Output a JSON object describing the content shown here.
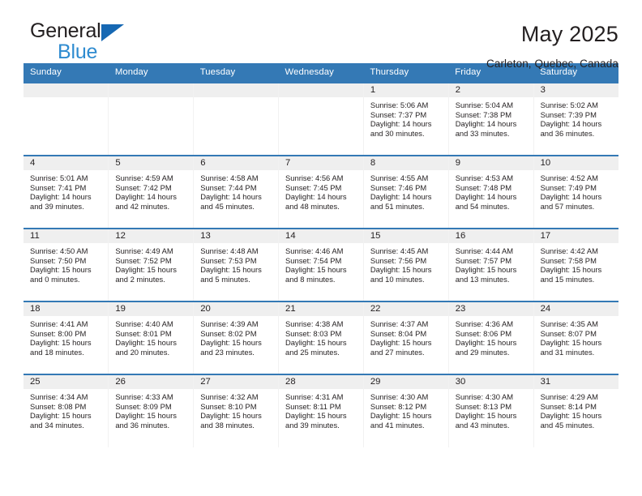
{
  "brand": {
    "name_line1": "General",
    "name_line2": "Blue",
    "triangle_color": "#1668b3",
    "blue_text_color": "#2e8bd0"
  },
  "header": {
    "title": "May 2025",
    "subtitle": "Carleton, Quebec, Canada"
  },
  "theme": {
    "header_bar_color": "#3479b5",
    "daynum_band_color": "#efefef",
    "text_color": "#231f20"
  },
  "weekday_headers": [
    "Sunday",
    "Monday",
    "Tuesday",
    "Wednesday",
    "Thursday",
    "Friday",
    "Saturday"
  ],
  "labels": {
    "sunrise_prefix": "Sunrise:",
    "sunset_prefix": "Sunset:",
    "daylight_prefix": "Daylight:"
  },
  "weeks": [
    [
      {
        "day": "",
        "empty": true
      },
      {
        "day": "",
        "empty": true
      },
      {
        "day": "",
        "empty": true
      },
      {
        "day": "",
        "empty": true
      },
      {
        "day": "1",
        "sunrise": "Sunrise: 5:06 AM",
        "sunset": "Sunset: 7:37 PM",
        "daylight_line1": "Daylight: 14 hours",
        "daylight_line2": "and 30 minutes."
      },
      {
        "day": "2",
        "sunrise": "Sunrise: 5:04 AM",
        "sunset": "Sunset: 7:38 PM",
        "daylight_line1": "Daylight: 14 hours",
        "daylight_line2": "and 33 minutes."
      },
      {
        "day": "3",
        "sunrise": "Sunrise: 5:02 AM",
        "sunset": "Sunset: 7:39 PM",
        "daylight_line1": "Daylight: 14 hours",
        "daylight_line2": "and 36 minutes."
      }
    ],
    [
      {
        "day": "4",
        "sunrise": "Sunrise: 5:01 AM",
        "sunset": "Sunset: 7:41 PM",
        "daylight_line1": "Daylight: 14 hours",
        "daylight_line2": "and 39 minutes."
      },
      {
        "day": "5",
        "sunrise": "Sunrise: 4:59 AM",
        "sunset": "Sunset: 7:42 PM",
        "daylight_line1": "Daylight: 14 hours",
        "daylight_line2": "and 42 minutes."
      },
      {
        "day": "6",
        "sunrise": "Sunrise: 4:58 AM",
        "sunset": "Sunset: 7:44 PM",
        "daylight_line1": "Daylight: 14 hours",
        "daylight_line2": "and 45 minutes."
      },
      {
        "day": "7",
        "sunrise": "Sunrise: 4:56 AM",
        "sunset": "Sunset: 7:45 PM",
        "daylight_line1": "Daylight: 14 hours",
        "daylight_line2": "and 48 minutes."
      },
      {
        "day": "8",
        "sunrise": "Sunrise: 4:55 AM",
        "sunset": "Sunset: 7:46 PM",
        "daylight_line1": "Daylight: 14 hours",
        "daylight_line2": "and 51 minutes."
      },
      {
        "day": "9",
        "sunrise": "Sunrise: 4:53 AM",
        "sunset": "Sunset: 7:48 PM",
        "daylight_line1": "Daylight: 14 hours",
        "daylight_line2": "and 54 minutes."
      },
      {
        "day": "10",
        "sunrise": "Sunrise: 4:52 AM",
        "sunset": "Sunset: 7:49 PM",
        "daylight_line1": "Daylight: 14 hours",
        "daylight_line2": "and 57 minutes."
      }
    ],
    [
      {
        "day": "11",
        "sunrise": "Sunrise: 4:50 AM",
        "sunset": "Sunset: 7:50 PM",
        "daylight_line1": "Daylight: 15 hours",
        "daylight_line2": "and 0 minutes."
      },
      {
        "day": "12",
        "sunrise": "Sunrise: 4:49 AM",
        "sunset": "Sunset: 7:52 PM",
        "daylight_line1": "Daylight: 15 hours",
        "daylight_line2": "and 2 minutes."
      },
      {
        "day": "13",
        "sunrise": "Sunrise: 4:48 AM",
        "sunset": "Sunset: 7:53 PM",
        "daylight_line1": "Daylight: 15 hours",
        "daylight_line2": "and 5 minutes."
      },
      {
        "day": "14",
        "sunrise": "Sunrise: 4:46 AM",
        "sunset": "Sunset: 7:54 PM",
        "daylight_line1": "Daylight: 15 hours",
        "daylight_line2": "and 8 minutes."
      },
      {
        "day": "15",
        "sunrise": "Sunrise: 4:45 AM",
        "sunset": "Sunset: 7:56 PM",
        "daylight_line1": "Daylight: 15 hours",
        "daylight_line2": "and 10 minutes."
      },
      {
        "day": "16",
        "sunrise": "Sunrise: 4:44 AM",
        "sunset": "Sunset: 7:57 PM",
        "daylight_line1": "Daylight: 15 hours",
        "daylight_line2": "and 13 minutes."
      },
      {
        "day": "17",
        "sunrise": "Sunrise: 4:42 AM",
        "sunset": "Sunset: 7:58 PM",
        "daylight_line1": "Daylight: 15 hours",
        "daylight_line2": "and 15 minutes."
      }
    ],
    [
      {
        "day": "18",
        "sunrise": "Sunrise: 4:41 AM",
        "sunset": "Sunset: 8:00 PM",
        "daylight_line1": "Daylight: 15 hours",
        "daylight_line2": "and 18 minutes."
      },
      {
        "day": "19",
        "sunrise": "Sunrise: 4:40 AM",
        "sunset": "Sunset: 8:01 PM",
        "daylight_line1": "Daylight: 15 hours",
        "daylight_line2": "and 20 minutes."
      },
      {
        "day": "20",
        "sunrise": "Sunrise: 4:39 AM",
        "sunset": "Sunset: 8:02 PM",
        "daylight_line1": "Daylight: 15 hours",
        "daylight_line2": "and 23 minutes."
      },
      {
        "day": "21",
        "sunrise": "Sunrise: 4:38 AM",
        "sunset": "Sunset: 8:03 PM",
        "daylight_line1": "Daylight: 15 hours",
        "daylight_line2": "and 25 minutes."
      },
      {
        "day": "22",
        "sunrise": "Sunrise: 4:37 AM",
        "sunset": "Sunset: 8:04 PM",
        "daylight_line1": "Daylight: 15 hours",
        "daylight_line2": "and 27 minutes."
      },
      {
        "day": "23",
        "sunrise": "Sunrise: 4:36 AM",
        "sunset": "Sunset: 8:06 PM",
        "daylight_line1": "Daylight: 15 hours",
        "daylight_line2": "and 29 minutes."
      },
      {
        "day": "24",
        "sunrise": "Sunrise: 4:35 AM",
        "sunset": "Sunset: 8:07 PM",
        "daylight_line1": "Daylight: 15 hours",
        "daylight_line2": "and 31 minutes."
      }
    ],
    [
      {
        "day": "25",
        "sunrise": "Sunrise: 4:34 AM",
        "sunset": "Sunset: 8:08 PM",
        "daylight_line1": "Daylight: 15 hours",
        "daylight_line2": "and 34 minutes."
      },
      {
        "day": "26",
        "sunrise": "Sunrise: 4:33 AM",
        "sunset": "Sunset: 8:09 PM",
        "daylight_line1": "Daylight: 15 hours",
        "daylight_line2": "and 36 minutes."
      },
      {
        "day": "27",
        "sunrise": "Sunrise: 4:32 AM",
        "sunset": "Sunset: 8:10 PM",
        "daylight_line1": "Daylight: 15 hours",
        "daylight_line2": "and 38 minutes."
      },
      {
        "day": "28",
        "sunrise": "Sunrise: 4:31 AM",
        "sunset": "Sunset: 8:11 PM",
        "daylight_line1": "Daylight: 15 hours",
        "daylight_line2": "and 39 minutes."
      },
      {
        "day": "29",
        "sunrise": "Sunrise: 4:30 AM",
        "sunset": "Sunset: 8:12 PM",
        "daylight_line1": "Daylight: 15 hours",
        "daylight_line2": "and 41 minutes."
      },
      {
        "day": "30",
        "sunrise": "Sunrise: 4:30 AM",
        "sunset": "Sunset: 8:13 PM",
        "daylight_line1": "Daylight: 15 hours",
        "daylight_line2": "and 43 minutes."
      },
      {
        "day": "31",
        "sunrise": "Sunrise: 4:29 AM",
        "sunset": "Sunset: 8:14 PM",
        "daylight_line1": "Daylight: 15 hours",
        "daylight_line2": "and 45 minutes."
      }
    ]
  ]
}
